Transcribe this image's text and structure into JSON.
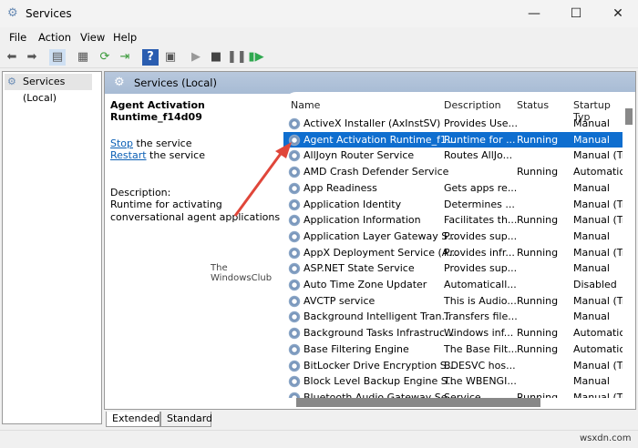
{
  "window": {
    "title": "Services",
    "minimize": "—",
    "maximize": "☐",
    "close": "✕"
  },
  "menu": [
    "File",
    "Action",
    "View",
    "Help"
  ],
  "toolbar": [
    "back-icon",
    "forward-icon",
    "show-tree-icon",
    "properties-icon",
    "refresh-icon",
    "export-icon",
    "help-icon",
    "console-icon",
    "start-icon",
    "stop-icon",
    "pause-icon",
    "resume-icon"
  ],
  "tree": {
    "root": "Services (Local)"
  },
  "header": {
    "title": "Services (Local)"
  },
  "details": {
    "service_name": "Agent Activation Runtime_f14d09",
    "stop_link": "Stop",
    "stop_suffix": " the service",
    "restart_link": "Restart",
    "restart_suffix": " the service",
    "description_label": "Description:",
    "description": "Runtime for activating conversational agent applications"
  },
  "columns": [
    "Name",
    "Description",
    "Status",
    "Startup Typ"
  ],
  "rows": [
    [
      "ActiveX Installer (AxInstSV)",
      "Provides Use...",
      "",
      "Manual"
    ],
    [
      "Agent Activation Runtime_f1...",
      "Runtime for ...",
      "Running",
      "Manual"
    ],
    [
      "AllJoyn Router Service",
      "Routes AllJo...",
      "",
      "Manual (Tri"
    ],
    [
      "AMD Crash Defender Service",
      "",
      "Running",
      "Automatic"
    ],
    [
      "App Readiness",
      "Gets apps re...",
      "",
      "Manual"
    ],
    [
      "Application Identity",
      "Determines ...",
      "",
      "Manual (Tri"
    ],
    [
      "Application Information",
      "Facilitates th...",
      "Running",
      "Manual (Tri"
    ],
    [
      "Application Layer Gateway S...",
      "Provides sup...",
      "",
      "Manual"
    ],
    [
      "AppX Deployment Service (A...",
      "Provides infr...",
      "Running",
      "Manual (Tri"
    ],
    [
      "ASP.NET State Service",
      "Provides sup...",
      "",
      "Manual"
    ],
    [
      "Auto Time Zone Updater",
      "Automaticall...",
      "",
      "Disabled"
    ],
    [
      "AVCTP service",
      "This is Audio...",
      "Running",
      "Manual (Tri"
    ],
    [
      "Background Intelligent Tran...",
      "Transfers file...",
      "",
      "Manual"
    ],
    [
      "Background Tasks Infrastruc...",
      "Windows inf...",
      "Running",
      "Automatic"
    ],
    [
      "Base Filtering Engine",
      "The Base Filt...",
      "Running",
      "Automatic"
    ],
    [
      "BitLocker Drive Encryption S...",
      "BDESVC hos...",
      "",
      "Manual (Tri"
    ],
    [
      "Block Level Backup Engine S...",
      "The WBENGI...",
      "",
      "Manual"
    ],
    [
      "Bluetooth Audio Gateway Se...",
      "Service ...",
      "Running",
      "Manual (Tri"
    ]
  ],
  "selected_index": 1,
  "tabs": [
    "Extended",
    "Standard"
  ],
  "watermark": {
    "line1": "The",
    "line2": "WindowsClub"
  },
  "site_watermark": "wsxdn.com",
  "colors": {
    "selection": "#0f6ecf",
    "band": "#a7bbd4",
    "link": "#0b5fb5",
    "arrow": "#e0463a"
  }
}
